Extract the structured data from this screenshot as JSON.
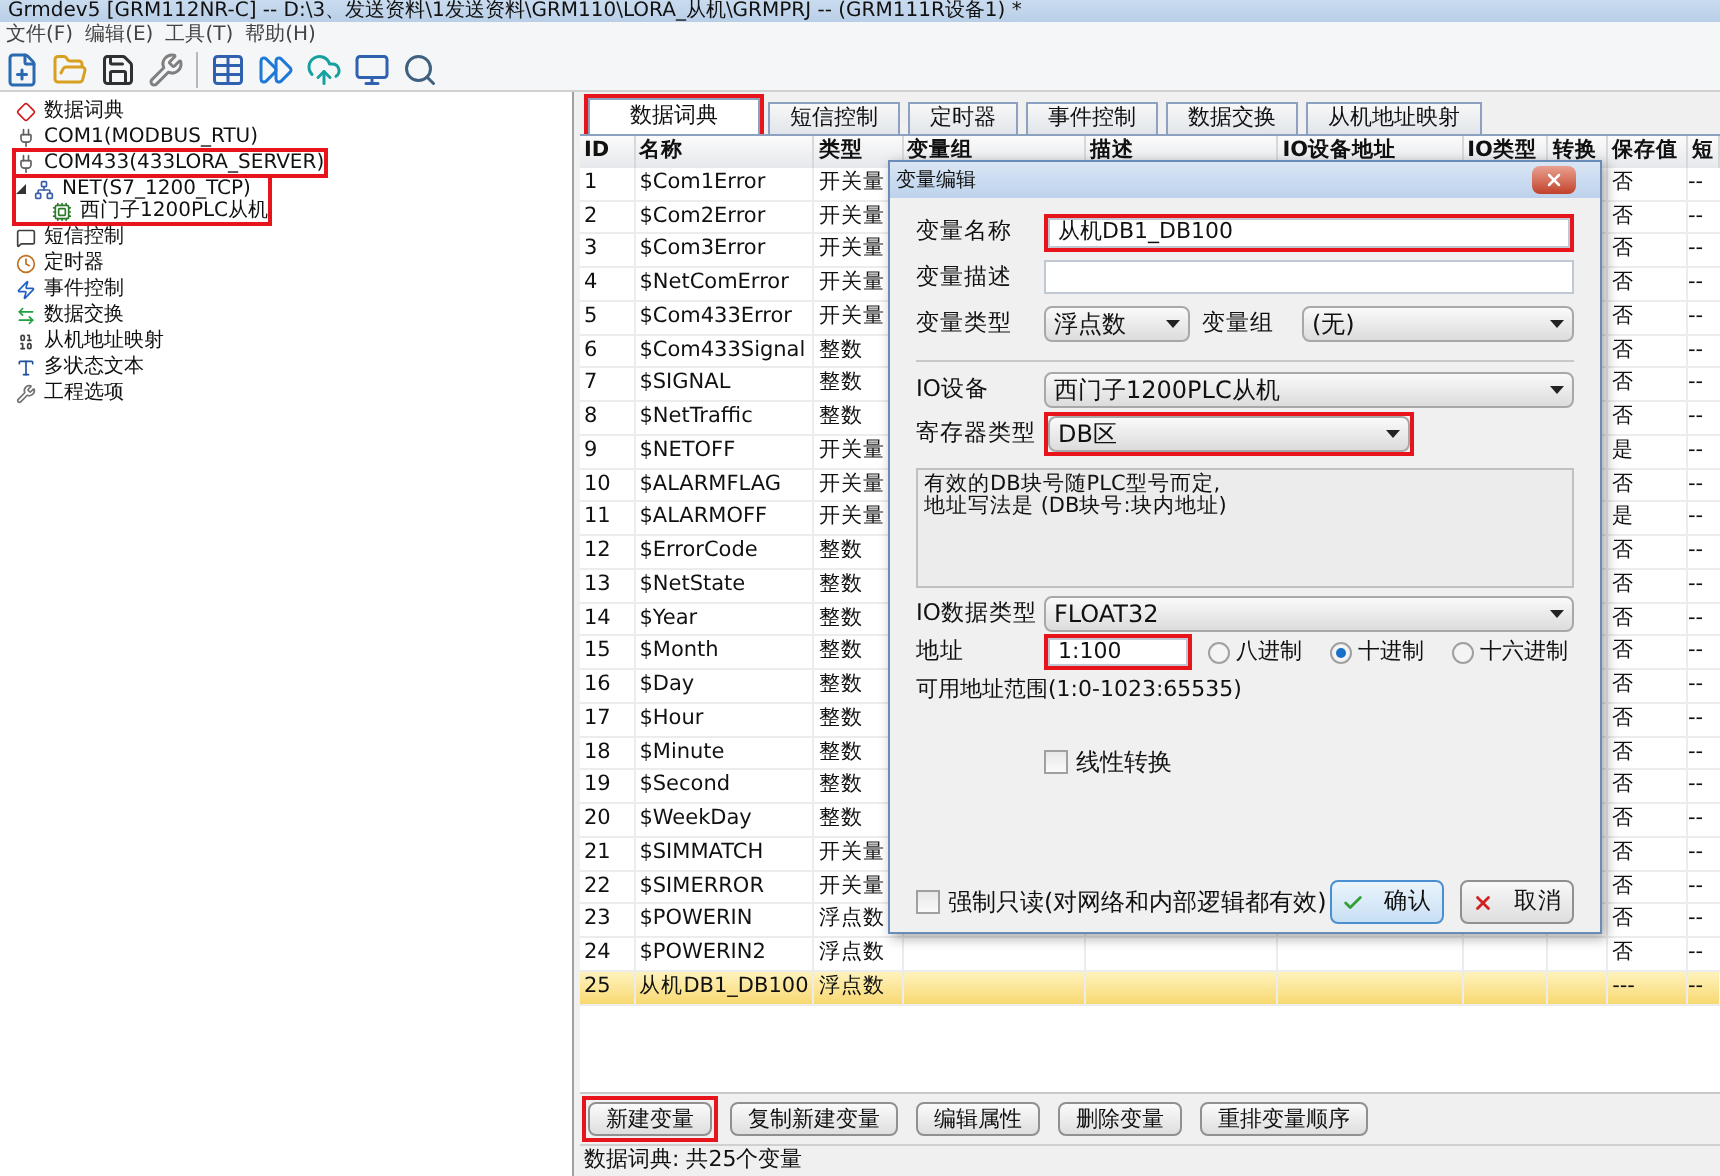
{
  "window": {
    "title": "Grmdev5 [GRM112NR-C]  -- D:\\3、发送资料\\1发送资料\\GRM110\\LORA_从机\\GRMPRJ -- (GRM111R设备1) *"
  },
  "menu": [
    "文件(F)",
    "编辑(E)",
    "工具(T)",
    "帮助(H)"
  ],
  "tree": [
    {
      "label": "数据词典",
      "highlighted": false
    },
    {
      "label": "COM1(MODBUS_RTU)",
      "highlighted": false
    },
    {
      "label": "COM433(433LORA_SERVER)",
      "highlighted": true
    },
    {
      "label": "NET(S7_1200_TCP)",
      "highlighted": true,
      "expanded": true,
      "children": [
        {
          "label": "西门子1200PLC从机"
        }
      ]
    },
    {
      "label": "短信控制",
      "highlighted": false
    },
    {
      "label": "定时器",
      "highlighted": false
    },
    {
      "label": "事件控制",
      "highlighted": false
    },
    {
      "label": "数据交换",
      "highlighted": false
    },
    {
      "label": "从机地址映射",
      "highlighted": false
    },
    {
      "label": "多状态文本",
      "highlighted": false
    },
    {
      "label": "工程选项",
      "highlighted": false
    }
  ],
  "tabs": [
    {
      "label": "数据词典",
      "selected": true,
      "highlighted": true
    },
    {
      "label": "短信控制",
      "selected": false,
      "highlighted": false
    },
    {
      "label": "定时器",
      "selected": false,
      "highlighted": false
    },
    {
      "label": "事件控制",
      "selected": false,
      "highlighted": false
    },
    {
      "label": "数据交换",
      "selected": false,
      "highlighted": false
    },
    {
      "label": "从机地址映射",
      "selected": false,
      "highlighted": false
    }
  ],
  "table": {
    "columns": [
      "ID",
      "名称",
      "类型",
      "变量组",
      "描述",
      "IO设备地址",
      "IO类型",
      "转换",
      "保存值",
      "短"
    ],
    "rows": [
      {
        "id": "1",
        "name": "$Com1Error",
        "type": "开关量",
        "save": "否",
        "short": "--",
        "selected": false
      },
      {
        "id": "2",
        "name": "$Com2Error",
        "type": "开关量",
        "save": "否",
        "short": "--",
        "selected": false
      },
      {
        "id": "3",
        "name": "$Com3Error",
        "type": "开关量",
        "save": "否",
        "short": "--",
        "selected": false
      },
      {
        "id": "4",
        "name": "$NetComError",
        "type": "开关量",
        "save": "否",
        "short": "--",
        "selected": false
      },
      {
        "id": "5",
        "name": "$Com433Error",
        "type": "开关量",
        "save": "否",
        "short": "--",
        "selected": false
      },
      {
        "id": "6",
        "name": "$Com433Signal",
        "type": "整数",
        "save": "否",
        "short": "--",
        "selected": false
      },
      {
        "id": "7",
        "name": "$SIGNAL",
        "type": "整数",
        "save": "否",
        "short": "--",
        "selected": false
      },
      {
        "id": "8",
        "name": "$NetTraffic",
        "type": "整数",
        "save": "否",
        "short": "--",
        "selected": false
      },
      {
        "id": "9",
        "name": "$NETOFF",
        "type": "开关量",
        "save": "是",
        "short": "--",
        "selected": false
      },
      {
        "id": "10",
        "name": "$ALARMFLAG",
        "type": "开关量",
        "save": "否",
        "short": "--",
        "selected": false
      },
      {
        "id": "11",
        "name": "$ALARMOFF",
        "type": "开关量",
        "save": "是",
        "short": "--",
        "selected": false
      },
      {
        "id": "12",
        "name": "$ErrorCode",
        "type": "整数",
        "save": "否",
        "short": "--",
        "selected": false
      },
      {
        "id": "13",
        "name": "$NetState",
        "type": "整数",
        "save": "否",
        "short": "--",
        "selected": false
      },
      {
        "id": "14",
        "name": "$Year",
        "type": "整数",
        "save": "否",
        "short": "--",
        "selected": false
      },
      {
        "id": "15",
        "name": "$Month",
        "type": "整数",
        "save": "否",
        "short": "--",
        "selected": false
      },
      {
        "id": "16",
        "name": "$Day",
        "type": "整数",
        "save": "否",
        "short": "--",
        "selected": false
      },
      {
        "id": "17",
        "name": "$Hour",
        "type": "整数",
        "save": "否",
        "short": "--",
        "selected": false
      },
      {
        "id": "18",
        "name": "$Minute",
        "type": "整数",
        "save": "否",
        "short": "--",
        "selected": false
      },
      {
        "id": "19",
        "name": "$Second",
        "type": "整数",
        "save": "否",
        "short": "--",
        "selected": false
      },
      {
        "id": "20",
        "name": "$WeekDay",
        "type": "整数",
        "save": "否",
        "short": "--",
        "selected": false
      },
      {
        "id": "21",
        "name": "$SIMMATCH",
        "type": "开关量",
        "save": "否",
        "short": "--",
        "selected": false
      },
      {
        "id": "22",
        "name": "$SIMERROR",
        "type": "开关量",
        "save": "否",
        "short": "--",
        "selected": false
      },
      {
        "id": "23",
        "name": "$POWERIN",
        "type": "浮点数",
        "save": "否",
        "short": "--",
        "selected": false
      },
      {
        "id": "24",
        "name": "$POWERIN2",
        "type": "浮点数",
        "save": "否",
        "short": "--",
        "selected": false
      },
      {
        "id": "25",
        "name": "从机DB1_DB100",
        "type": "浮点数",
        "save": "---",
        "short": "--",
        "selected": true
      }
    ]
  },
  "buttons": [
    {
      "label": "新建变量",
      "highlighted": true
    },
    {
      "label": "复制新建变量",
      "highlighted": false
    },
    {
      "label": "编辑属性",
      "highlighted": false
    },
    {
      "label": "删除变量",
      "highlighted": false
    },
    {
      "label": "重排变量顺序",
      "highlighted": false
    }
  ],
  "status_bar": "数据词典: 共25个变量",
  "dialog": {
    "title": "变量编辑",
    "name": {
      "label": "变量名称",
      "value": "从机DB1_DB100",
      "highlighted": true
    },
    "description": {
      "label": "变量描述"
    },
    "var_type": {
      "label": "变量类型",
      "value": "浮点数"
    },
    "var_group": {
      "label": "变量组",
      "value": "(无)"
    },
    "io_device": {
      "label": "IO设备",
      "value": "西门子1200PLC从机"
    },
    "register_type": {
      "label": "寄存器类型",
      "value": "DB区",
      "highlighted": true
    },
    "info": [
      "有效的DB块号随PLC型号而定,",
      "地址写法是 (DB块号:块内地址)"
    ],
    "io_data_type": {
      "label": "IO数据类型",
      "value": "FLOAT32"
    },
    "address": {
      "label": "地址",
      "value": "1:100",
      "highlighted": true
    },
    "radix": [
      {
        "label": "八进制",
        "selected": false
      },
      {
        "label": "十进制",
        "selected": true
      },
      {
        "label": "十六进制",
        "selected": false
      }
    ],
    "range": "可用地址范围(1:0-1023:65535)",
    "linear": {
      "label": "线性转换",
      "checked": false
    },
    "readonly": {
      "label": "强制只读(对网络和内部逻辑都有效)",
      "checked": false
    },
    "ok": "确认",
    "cancel": "取消"
  }
}
